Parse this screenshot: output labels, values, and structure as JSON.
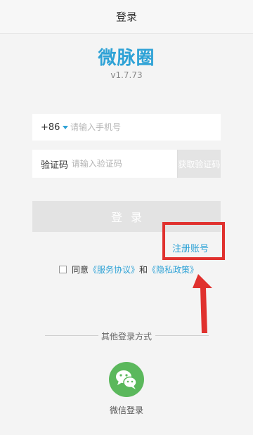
{
  "nav": {
    "title": "登录"
  },
  "brand": {
    "name": "微脉圈",
    "version": "v1.7.73"
  },
  "form": {
    "country_code": "+86",
    "phone_placeholder": "请输入手机号",
    "code_label": "验证码",
    "code_placeholder": "请输入验证码",
    "get_code_label": "获取验证码",
    "login_label": "登录"
  },
  "register_label": "注册账号",
  "agreement": {
    "prefix": "同意",
    "service_link": "《服务协议》",
    "and": "和",
    "privacy_link": "《隐私政策》"
  },
  "other_login": {
    "title": "其他登录方式",
    "wechat_label": "微信登录"
  },
  "colors": {
    "accent": "#2ea2d6",
    "annotation_red": "#e0312e",
    "wechat_green": "#5bb85c"
  }
}
